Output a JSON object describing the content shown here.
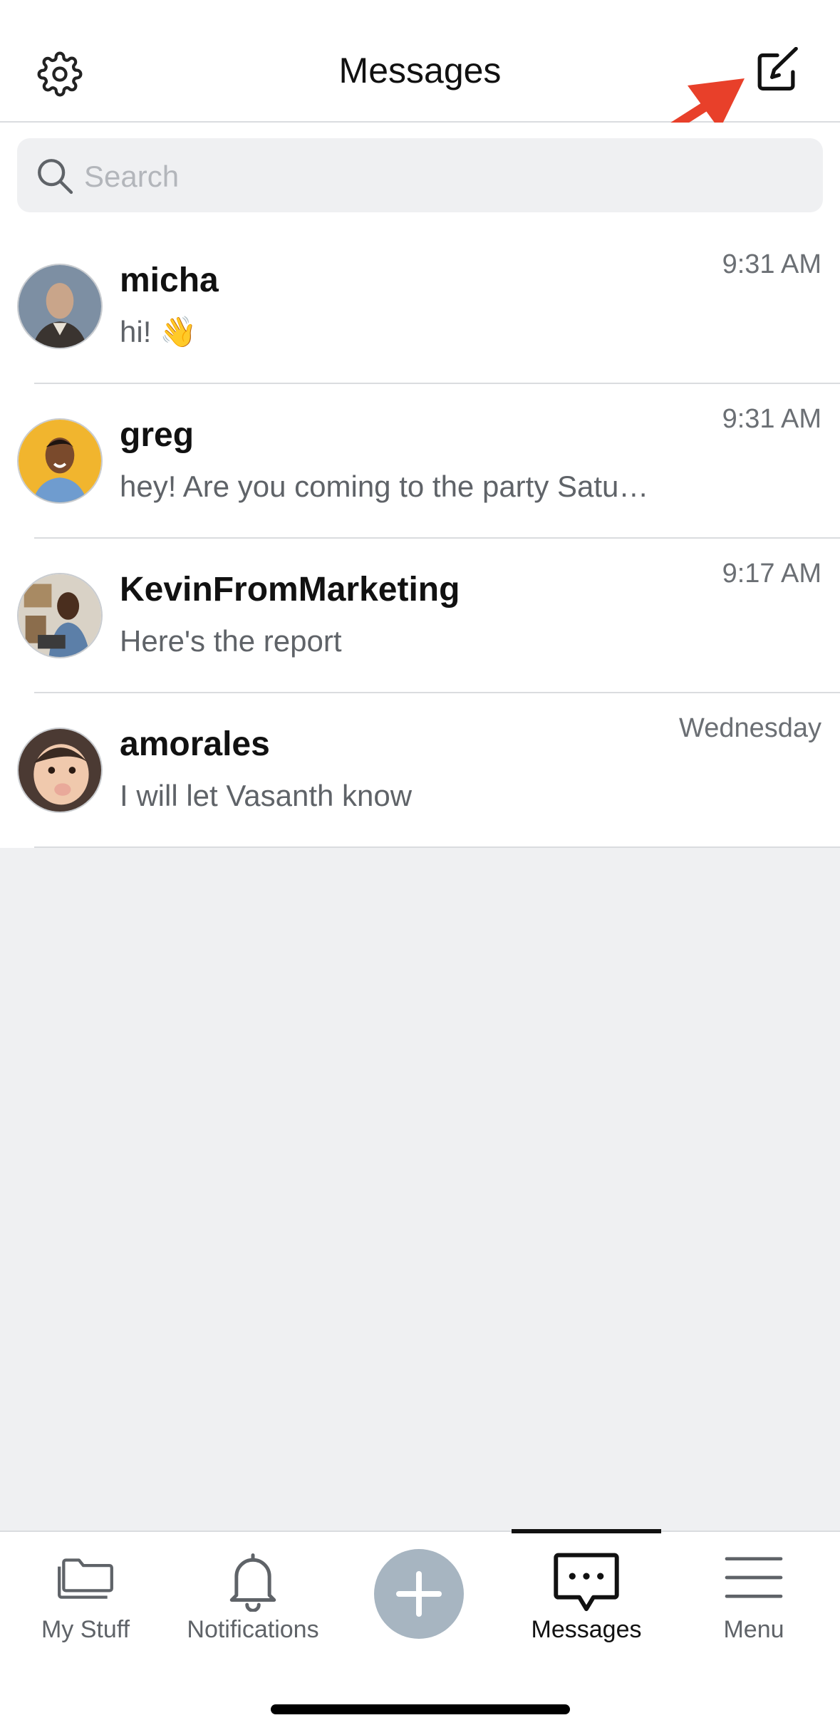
{
  "header": {
    "title": "Messages"
  },
  "search": {
    "placeholder": "Search"
  },
  "conversations": [
    {
      "name": "micha",
      "preview": "hi! 👋",
      "time": "9:31 AM"
    },
    {
      "name": "greg",
      "preview": "hey! Are you coming to the party Satu…",
      "time": "9:31 AM"
    },
    {
      "name": "KevinFromMarketing",
      "preview": "Here's the report",
      "time": "9:17 AM"
    },
    {
      "name": "amorales",
      "preview": "I will let Vasanth know",
      "time": "Wednesday"
    }
  ],
  "tabbar": {
    "mystuff": "My Stuff",
    "notifications": "Notifications",
    "messages": "Messages",
    "menu": "Menu"
  },
  "colors": {
    "arrow": "#e8402a",
    "fab": "#a7b5c1",
    "background": "#eff0f2"
  }
}
